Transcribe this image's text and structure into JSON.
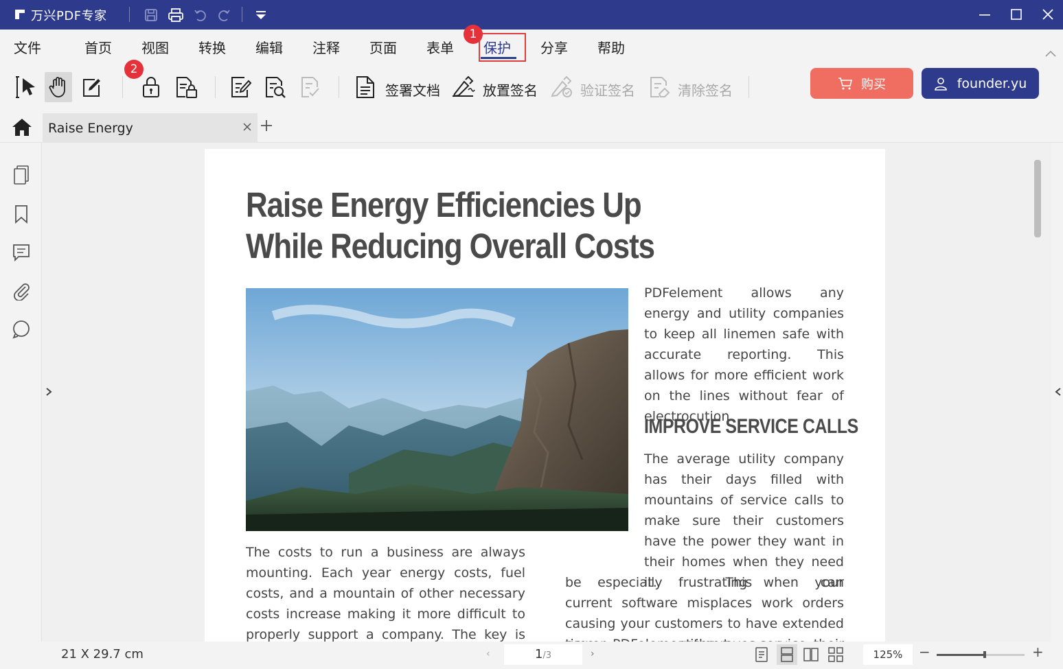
{
  "app": {
    "title": "万兴PDF专家"
  },
  "menu": {
    "items": [
      {
        "label": "文件"
      },
      {
        "label": "首页"
      },
      {
        "label": "视图"
      },
      {
        "label": "转换"
      },
      {
        "label": "编辑"
      },
      {
        "label": "注释"
      },
      {
        "label": "页面"
      },
      {
        "label": "表单"
      },
      {
        "label": "保护",
        "active": true
      },
      {
        "label": "分享"
      },
      {
        "label": "帮助"
      }
    ]
  },
  "annotations": {
    "badge1": "1",
    "badge2": "2"
  },
  "toolbar": {
    "sign_document": "签署文档",
    "place_signature": "放置签名",
    "verify_signature": "验证签名",
    "clear_signature": "清除签名",
    "buy": "购买",
    "user": "founder.yu"
  },
  "tabs": {
    "active": "Raise Energy",
    "close_glyph": "×",
    "add_glyph": "+"
  },
  "document": {
    "title": "Raise Energy Efficiencies Up While Reducing Overall Costs",
    "para_right_1": "PDFelement allows any energy and utility companies to keep all linemen safe with accurate reporting. This allows for more efficient work on the lines without fear of electrocution.",
    "section_heading": "IMPROVE SERVICE CALLS",
    "para_right_2": "The average utility company has their days filled with mountains of service calls to make sure their customers have the power they want in their homes when they need it. This can",
    "para_right_3": "be especially frustrating when your current software misplaces work orders causing your customers to have extended time without their",
    "para_right_4": "power. PDFelement improves service",
    "para_left_1": "The costs to run a business are always mounting. Each year energy costs, fuel costs, and a mountain of other necessary costs increase making it more difficult to properly support a company. The key is not always to"
  },
  "status": {
    "page_size": "21 X 29.7 cm",
    "current_page": "1",
    "total_pages": "/3",
    "zoom": "125%",
    "zoom_level": 0.55,
    "prev": "‹",
    "next": "›",
    "minus": "−",
    "plus": "+"
  },
  "colors": {
    "brand": "#2e3a8c",
    "buy_button": "#f06e61",
    "badge": "#e5323a",
    "highlight": "#e23b3b"
  }
}
